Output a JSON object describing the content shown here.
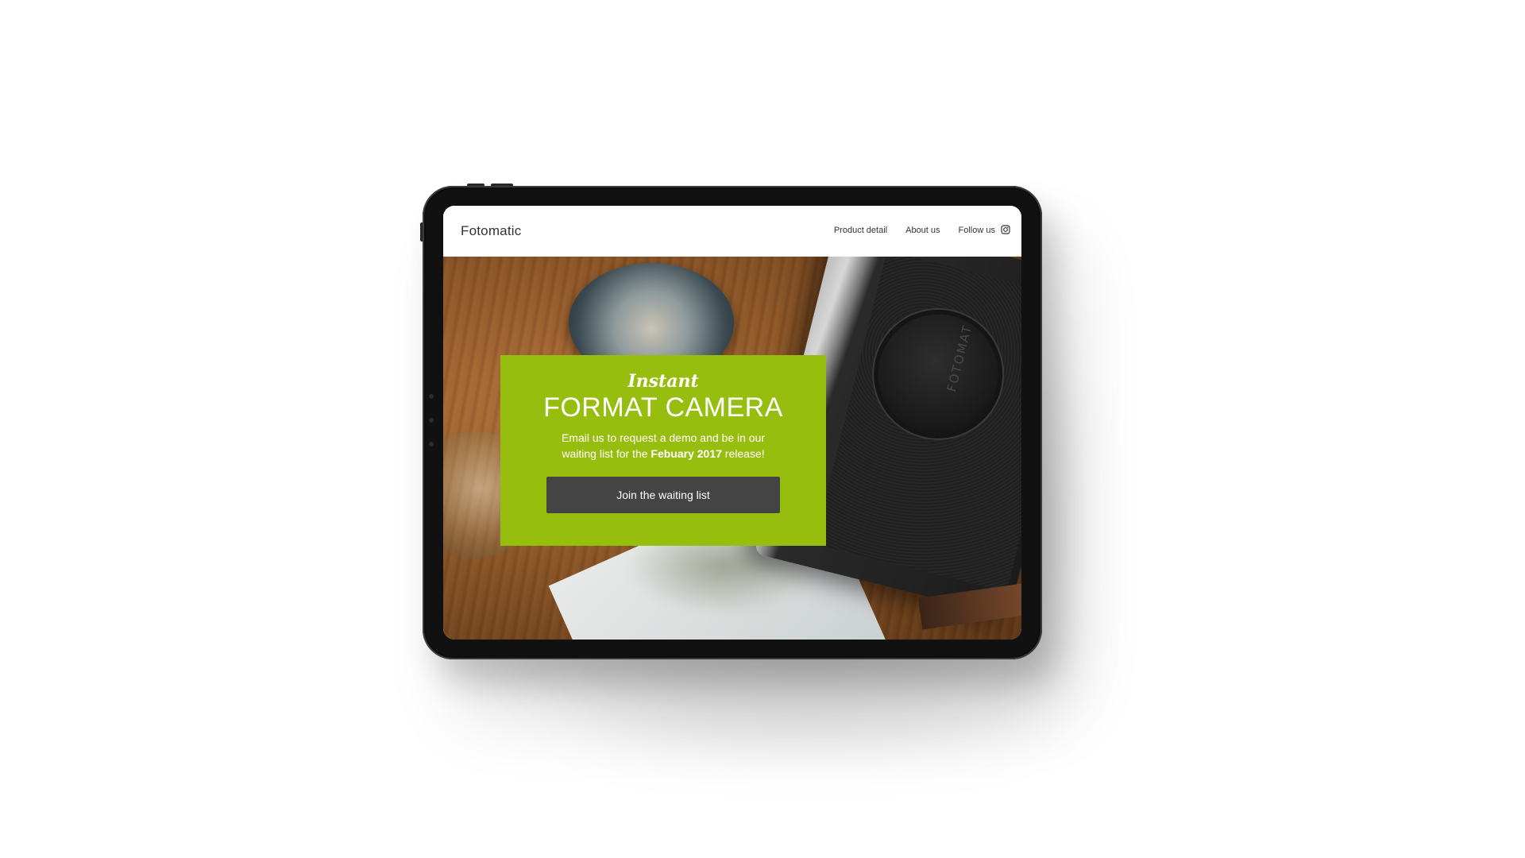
{
  "site": {
    "brand": "Fotomatic"
  },
  "nav": {
    "items": [
      {
        "label": "Product detail"
      },
      {
        "label": "About us"
      },
      {
        "label": "Follow us",
        "icon": "instagram-icon"
      }
    ]
  },
  "hero": {
    "script_heading": "Instant",
    "title": "FORMAT CAMERA",
    "text_before": "Email us to request a demo and be in our waiting list for the ",
    "text_bold": "Febuary 2017",
    "text_after": " release!",
    "cta_label": "Join the waiting list",
    "lens_cap_text": "FOTOMAT"
  },
  "colors": {
    "accent": "#97bd0e",
    "button": "#444444",
    "device_frame": "#111111"
  }
}
